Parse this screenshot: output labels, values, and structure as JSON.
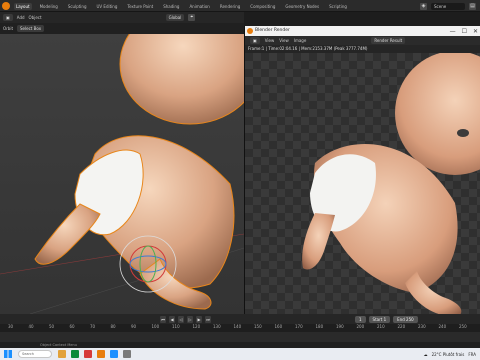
{
  "app": {
    "workspace_tabs": [
      "Layout",
      "Modeling",
      "Sculpting",
      "UV Editing",
      "Texture Paint",
      "Shading",
      "Animation",
      "Rendering",
      "Compositing",
      "Geometry Nodes",
      "Scripting"
    ],
    "scene_label": "Scene"
  },
  "viewport": {
    "header": {
      "menu_items": [
        "Add",
        "Object"
      ],
      "orientation_label": "Global"
    },
    "header2": {
      "mode_label": "Orbit",
      "select_label": "Select Box"
    }
  },
  "render_window": {
    "title": "Blender Render",
    "menu_items": [
      "View",
      "View",
      "Image"
    ],
    "slot_label": "Render Result",
    "info_text": "Frame:1 | Time:02:04.16 | Mem:2153.37M (Peak 3777.74M)"
  },
  "timeline": {
    "start_label": "Start",
    "start_value": "1",
    "end_label": "End",
    "end_value": "250",
    "current_frame": "1",
    "ruler_ticks": [
      "30",
      "40",
      "50",
      "60",
      "70",
      "80",
      "90",
      "100",
      "110",
      "120",
      "130",
      "140",
      "150",
      "160",
      "170",
      "180",
      "190",
      "200",
      "210",
      "220",
      "230",
      "240",
      "250"
    ]
  },
  "statusbar": {
    "hint": "Object Context Menu"
  },
  "taskbar": {
    "search_placeholder": "Search",
    "weather": "22°C  Plutôt frais",
    "lang": "FRA",
    "colors": [
      "#1f6fd6",
      "#e2a23b",
      "#0b8a3a",
      "#d63a3a",
      "#e87d0d",
      "#1b90ff",
      "#7a7a7a"
    ]
  }
}
